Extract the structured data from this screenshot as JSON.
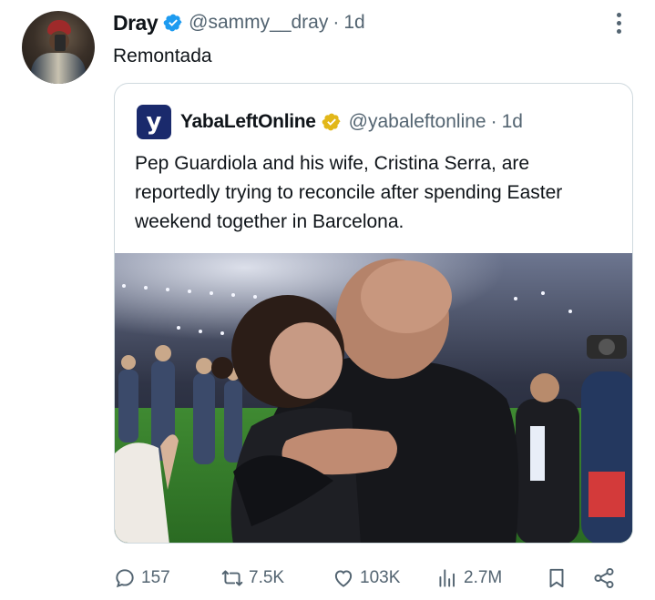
{
  "tweet": {
    "author_name": "Dray",
    "handle": "@sammy__dray",
    "separator": "·",
    "time": "1d",
    "text": "Remontada"
  },
  "quoted": {
    "avatar_letter": "y",
    "author_name": "YabaLeftOnline",
    "handle": "@yabaleftonline",
    "separator": "·",
    "time": "1d",
    "text": "Pep Guardiola and his wife, Cristina Serra, are reportedly trying to reconcile after spending Easter weekend together in Barcelona."
  },
  "actions": {
    "replies": "157",
    "reposts": "7.5K",
    "likes": "103K",
    "views": "2.7M"
  },
  "icons": {
    "verified_author": "blue-check-icon",
    "verified_quoted": "gold-check-icon",
    "more": "more-vertical-icon",
    "reply": "reply-icon",
    "repost": "repost-icon",
    "like": "heart-icon",
    "views": "views-icon",
    "bookmark": "bookmark-icon",
    "share": "share-icon"
  },
  "colors": {
    "blue_check": "#1d9bf0",
    "gold_check": "#e2b719",
    "secondary_text": "#536471",
    "quote_avatar_bg": "#1a2a6c"
  }
}
